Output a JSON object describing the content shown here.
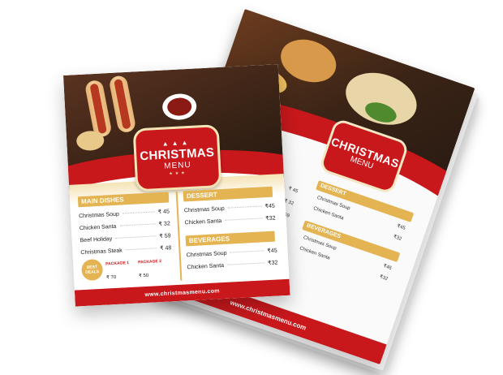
{
  "flyer": {
    "title": "CHRISTMAS",
    "subtitle": "MENU",
    "website": "www.christmasmenu.com",
    "sections": {
      "main_dishes": {
        "heading": "MAIN DISHES",
        "items": [
          {
            "name": "Christmas Soup",
            "price": "₹ 45"
          },
          {
            "name": "Chicken Santa",
            "price": "₹ 32"
          },
          {
            "name": "Beef Holiday",
            "price": "₹ 59"
          },
          {
            "name": "Christmas Steak",
            "price": "₹ 48"
          }
        ]
      },
      "dessert": {
        "heading": "DESSERT",
        "items": [
          {
            "name": "Christmas Soup",
            "price": "₹45"
          },
          {
            "name": "Chicken Santa",
            "price": "₹32"
          }
        ]
      },
      "beverages": {
        "heading": "BEVERAGES",
        "items": [
          {
            "name": "Christmas Soup",
            "price": "₹45"
          },
          {
            "name": "Chicken Santa",
            "price": "₹32"
          }
        ]
      }
    },
    "best_deals": {
      "line1": "BEST",
      "line2": "DEALS"
    },
    "packages": [
      {
        "label": "PACKAGE 1",
        "price": "₹ 70"
      },
      {
        "label": "PACKAGE 2",
        "price": "₹ 50"
      }
    ]
  },
  "colors": {
    "red": "#c8181c",
    "gold": "#e3b451",
    "cream": "#f5e3b5"
  }
}
